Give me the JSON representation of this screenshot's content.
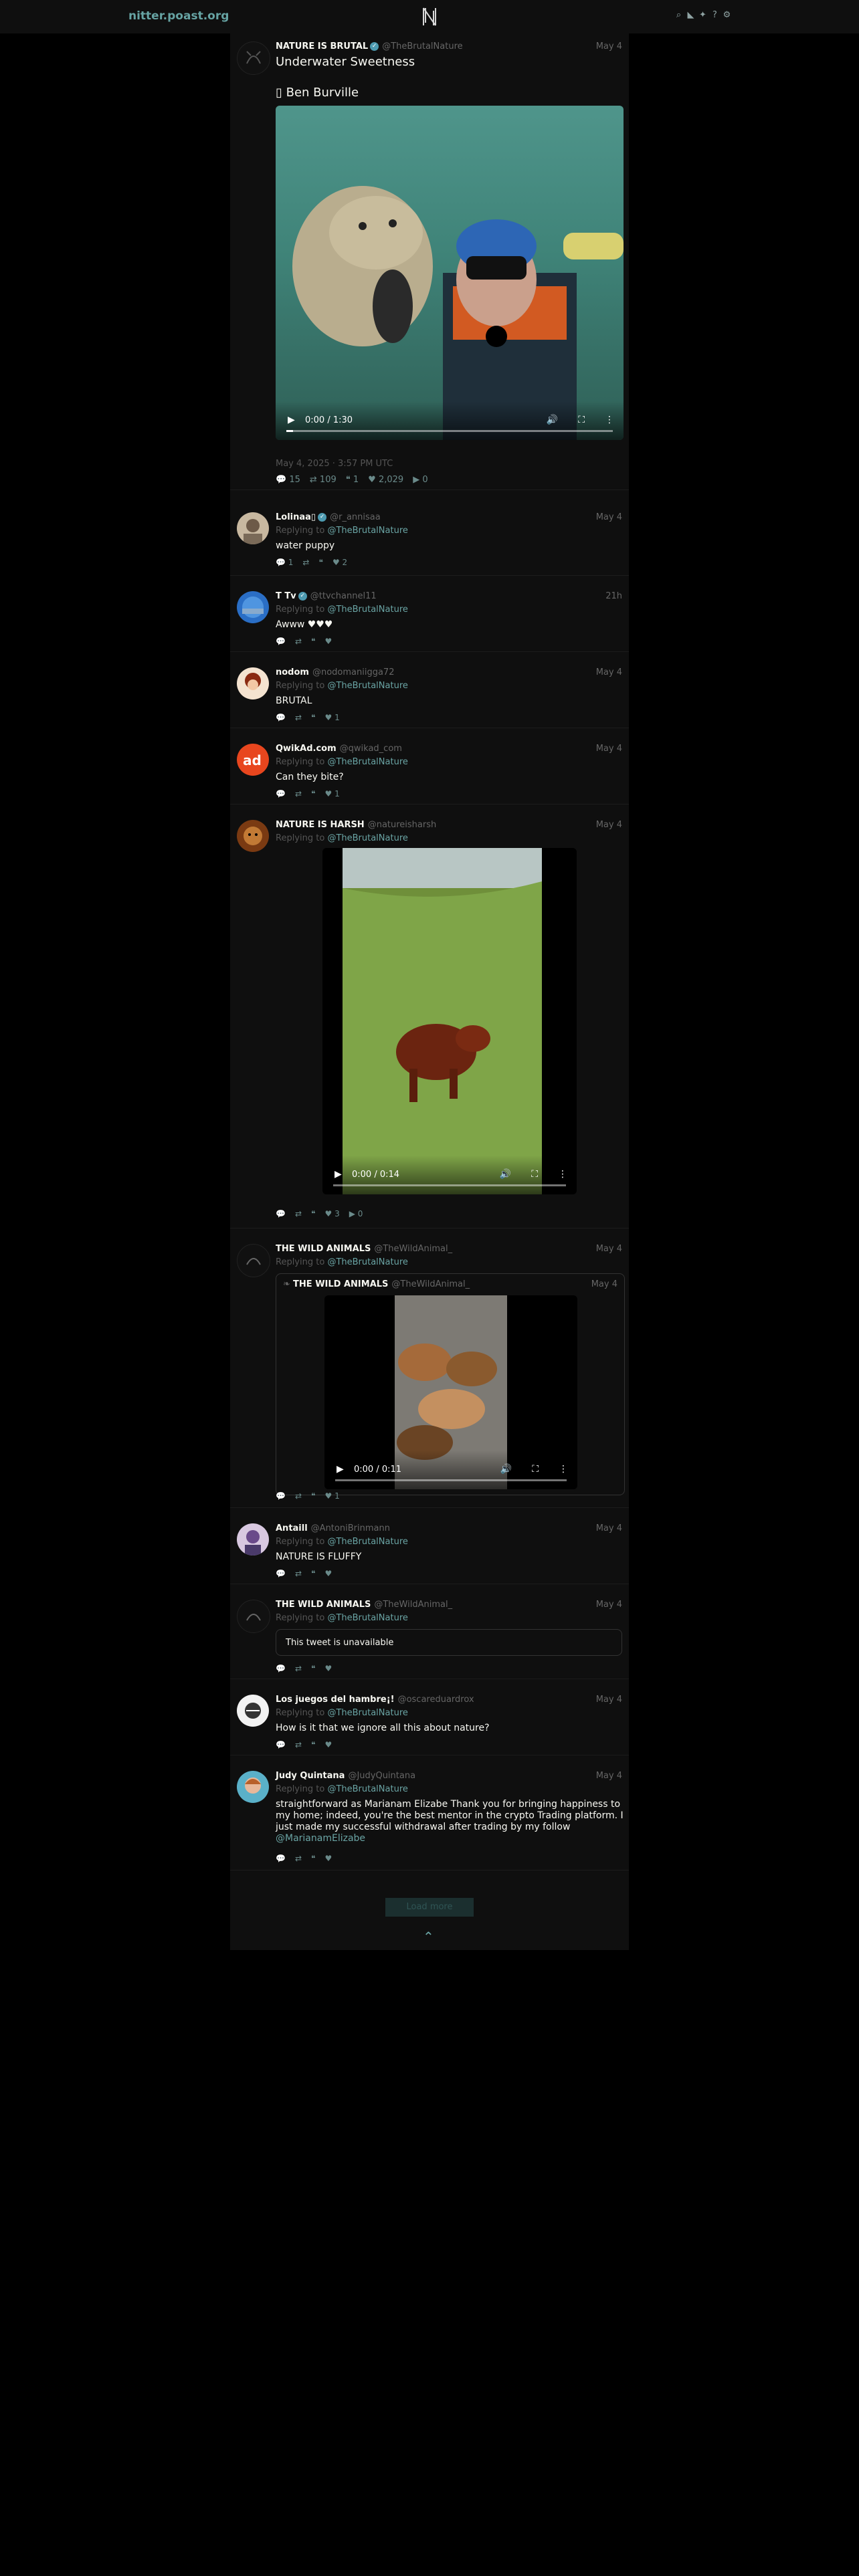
{
  "navbar": {
    "site_name": "nitter.poast.org",
    "logo_letter": "N",
    "icons": [
      "search-icon",
      "rss-icon",
      "bird-icon",
      "help-icon",
      "settings-icon"
    ]
  },
  "main_tweet": {
    "name": "NATURE IS BRUTAL",
    "handle": "@TheBrutalNature",
    "date": "May 4",
    "title": "Underwater Sweetness",
    "credit": "▯ Ben Burville",
    "video_time": "0:00 / 1:30",
    "video_progress": 0.02,
    "timestamp": "May 4, 2025 · 3:57 PM UTC",
    "stats": {
      "replies": "15",
      "retweets": "109",
      "quotes": "1",
      "likes": "2,029",
      "views": "0"
    }
  },
  "replies": [
    {
      "name": "Lolinaa▯",
      "handle": "@r_annisaa",
      "date": "May 4",
      "reply_to": "@TheBrutalNature",
      "text": "water puppy",
      "stats": {
        "replies": "1",
        "retweets": "",
        "quotes": "",
        "likes": "2"
      }
    },
    {
      "name": "T Tv",
      "handle": "@ttvchannel11",
      "date": "21h",
      "reply_to": "@TheBrutalNature",
      "text": "Awww ♥♥♥",
      "stats": {
        "replies": "",
        "retweets": "",
        "quotes": "",
        "likes": ""
      }
    },
    {
      "name": "nodom",
      "handle": "@nodomaniigga72",
      "date": "May 4",
      "reply_to": "@TheBrutalNature",
      "text": "BRUTAL",
      "stats": {
        "replies": "",
        "retweets": "",
        "quotes": "",
        "likes": "1"
      }
    },
    {
      "name": "QwikAd.com",
      "handle": "@qwikad_com",
      "date": "May 4",
      "reply_to": "@TheBrutalNature",
      "text": "Can they bite?",
      "stats": {
        "replies": "",
        "retweets": "",
        "quotes": "",
        "likes": "1"
      }
    },
    {
      "name": "NATURE IS HARSH",
      "handle": "@natureisharsh",
      "date": "May 4",
      "reply_to": "@TheBrutalNature",
      "video_time": "0:00 / 0:14",
      "stats": {
        "replies": "",
        "retweets": "",
        "quotes": "",
        "likes": "3",
        "views": "0"
      }
    },
    {
      "name": "THE WILD ANIMALS",
      "handle": "@TheWildAnimal_",
      "date": "May 4",
      "reply_to": "@TheBrutalNature",
      "quote": {
        "name": "THE WILD ANIMALS",
        "handle": "@TheWildAnimal_",
        "date": "May 4",
        "video_time": "0:00 / 0:11"
      },
      "stats": {
        "replies": "",
        "retweets": "",
        "quotes": "",
        "likes": "1"
      }
    },
    {
      "name": "Antaill",
      "handle": "@AntoniBrinmann",
      "date": "May 4",
      "reply_to": "@TheBrutalNature",
      "text": "NATURE IS FLUFFY",
      "stats": {
        "replies": "",
        "retweets": "",
        "quotes": "",
        "likes": ""
      }
    },
    {
      "name": "THE WILD ANIMALS",
      "handle": "@TheWildAnimal_",
      "date": "May 4",
      "reply_to": "@TheBrutalNature",
      "unavailable": "This tweet is unavailable",
      "stats": {
        "replies": "",
        "retweets": "",
        "quotes": "",
        "likes": ""
      }
    },
    {
      "name": "Los juegos del hambre¡!",
      "handle": "@oscareduardrox",
      "date": "May 4",
      "reply_to": "@TheBrutalNature",
      "text": "How is it that we ignore all this about nature?",
      "stats": {
        "replies": "",
        "retweets": "",
        "quotes": "",
        "likes": ""
      }
    },
    {
      "name": "Judy Quintana",
      "handle": "@JudyQuintana",
      "date": "May 4",
      "reply_to": "@TheBrutalNature",
      "text": "straightforward as Marianam Elizabe Thank you for bringing happiness to my home; indeed, you're the best mentor in the crypto Trading platform. I just made my successful withdrawal after trading by my follow",
      "mention": "@MarianamElizabe",
      "stats": {
        "replies": "",
        "retweets": "",
        "quotes": "",
        "likes": ""
      }
    }
  ],
  "labels": {
    "replying_to": "Replying to",
    "load_more": "Load more"
  },
  "colors": {
    "accent": "#6aa4a4",
    "background": "#0f0f0f"
  }
}
